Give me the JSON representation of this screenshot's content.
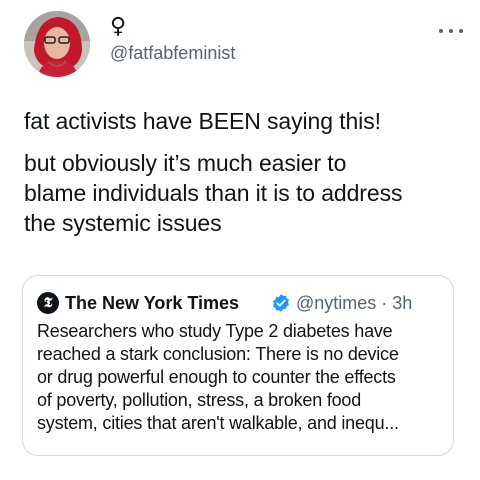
{
  "tweet": {
    "display_name": "♀",
    "handle": "@fatfabfeminist",
    "more_icon": "more-horizontal-icon",
    "text_paragraph_1": "fat activists have BEEN saying this!",
    "text_paragraph_2": "but obviously it’s much easier to\nblame individuals than it is to address\nthe systemic issues"
  },
  "quote": {
    "logo_glyph": "𝕿",
    "name": "The New York Times",
    "verified_icon": "verified-badge-icon",
    "handle_time": "@nytimes · 3h",
    "body": "Researchers who study Type 2 diabetes have\nreached a stark conclusion: There is no device\nor drug powerful enough to counter the effects\nof poverty, pollution, stress, a broken food\nsystem, cities that aren't walkable, and inequ..."
  },
  "colors": {
    "text": "#0f1419",
    "secondary": "#536471",
    "border": "#cfd9de",
    "verified": "#1d9bf0"
  }
}
